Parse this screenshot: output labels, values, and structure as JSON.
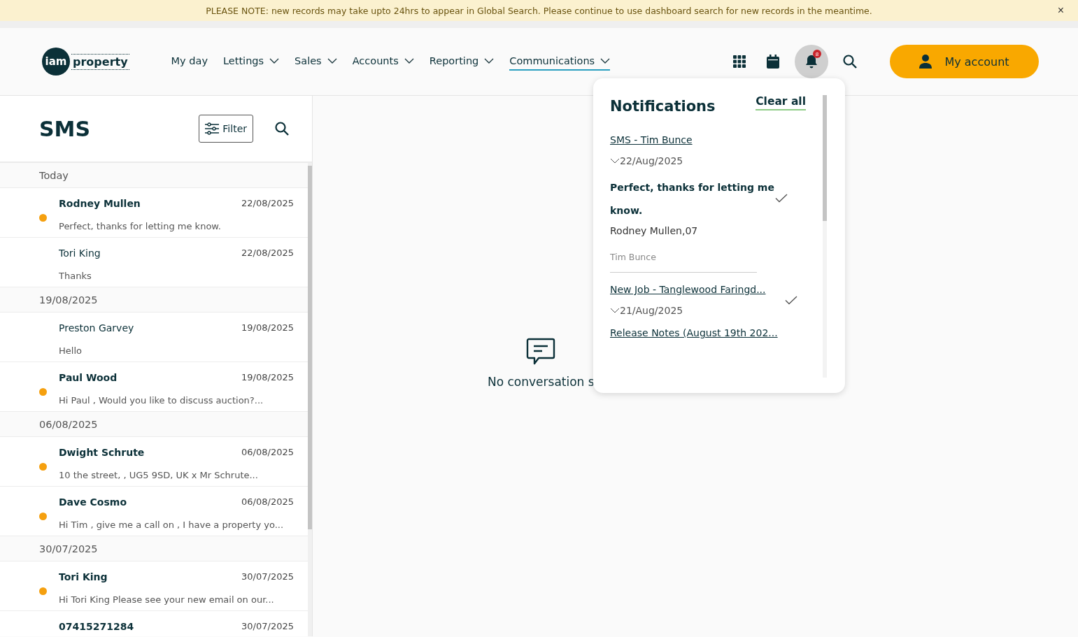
{
  "banner": {
    "text": "PLEASE NOTE: new records may take upto 24hrs to appear in Global Search. Please continue to use dashboard search for new records in the meantime.",
    "close": "×"
  },
  "header": {
    "logo": {
      "mark": "iam",
      "word": "property"
    },
    "nav": [
      {
        "label": "My day",
        "has_menu": false,
        "selected": false
      },
      {
        "label": "Lettings",
        "has_menu": true,
        "selected": false
      },
      {
        "label": "Sales",
        "has_menu": true,
        "selected": false
      },
      {
        "label": "Accounts",
        "has_menu": true,
        "selected": false
      },
      {
        "label": "Reporting",
        "has_menu": true,
        "selected": false
      },
      {
        "label": "Communications",
        "has_menu": true,
        "selected": true
      }
    ],
    "notification_count": "8",
    "notifications_open": true,
    "account_button": "My account"
  },
  "sms_panel": {
    "title": "SMS",
    "filter_button": "Filter",
    "groups": [
      {
        "label": "Today",
        "items": [
          {
            "name": "Rodney Mullen",
            "date": "22/08/2025",
            "preview": "Perfect, thanks for letting me know.",
            "unread": true
          },
          {
            "name": "Tori King",
            "date": "22/08/2025",
            "preview": "Thanks",
            "unread": false
          }
        ]
      },
      {
        "label": "19/08/2025",
        "items": [
          {
            "name": "Preston Garvey",
            "date": "19/08/2025",
            "preview": "Hello",
            "unread": false
          },
          {
            "name": "Paul Wood",
            "date": "19/08/2025",
            "preview": "Hi Paul , Would you like to discuss auction?...",
            "unread": true
          }
        ]
      },
      {
        "label": "06/08/2025",
        "items": [
          {
            "name": "Dwight Schrute",
            "date": "06/08/2025",
            "preview": "10 the street, , UG5 9SD, UK x Mr Schrute...",
            "unread": true
          },
          {
            "name": "Dave Cosmo",
            "date": "06/08/2025",
            "preview": "Hi Tim , give me a call on , I have a property yo...",
            "unread": true
          }
        ]
      },
      {
        "label": "30/07/2025",
        "items": [
          {
            "name": "Tori King",
            "date": "30/07/2025",
            "preview": "Hi Tori King Please see your new email on our...",
            "unread": true
          },
          {
            "name": "07415271284",
            "date": "30/07/2025",
            "unread": true
          }
        ]
      }
    ]
  },
  "empty_state": {
    "text": "No conversation s"
  },
  "notifications": {
    "title": "Notifications",
    "clear_all": "Clear all",
    "items": [
      {
        "title": "SMS - Tim Bunce",
        "date": "22/Aug/2025",
        "expanded": true,
        "message": "Perfect, thanks for letting me know.",
        "sender": "Rodney Mullen,07",
        "agent": "Tim Bunce",
        "read": true
      },
      {
        "title": "New Job - Tanglewood Faringd...",
        "date": "21/Aug/2025",
        "expanded": false,
        "read": true
      },
      {
        "title": "Release Notes (August 19th 202..."
      }
    ]
  }
}
